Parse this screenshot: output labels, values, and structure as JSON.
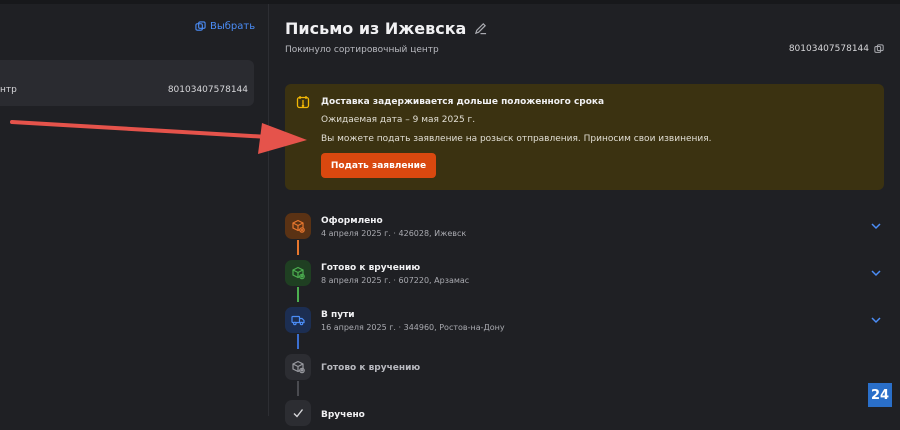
{
  "left_panel": {
    "select_label": "Выбрать",
    "item": {
      "suffix": "нтр",
      "tracking": "80103407578144"
    }
  },
  "header": {
    "title": "Письмо из Ижевска",
    "status": "Покинуло сортировочный центр",
    "tracking": "80103407578144"
  },
  "alert": {
    "heading": "Доставка задерживается дольше положенного срока",
    "expected": "Ожидаемая дата – 9 мая 2025 г.",
    "message": "Вы можете подать заявление на розыск отправления. Приносим свои извинения.",
    "button": "Подать заявление"
  },
  "timeline": [
    {
      "name": "Оформлено",
      "details": "4 апреля 2025 г. · 426028, Ижевск",
      "icon": "box-plus-icon",
      "color": "#e8772e"
    },
    {
      "name": "Готово к вручению",
      "details": "8 апреля 2025 г. · 607220, Арзамас",
      "icon": "box-location-icon",
      "color": "#4caf50"
    },
    {
      "name": "В пути",
      "details": "16 апреля 2025 г. · 344960, Ростов-на-Дону",
      "icon": "truck-icon",
      "color": "#4b8df7"
    },
    {
      "name": "Готово к вручению",
      "details": "",
      "icon": "box-location-icon",
      "color": "#9a9ba1"
    },
    {
      "name": "Вручено",
      "details": "",
      "icon": "check-icon",
      "color": "#9a9ba1"
    }
  ],
  "colors": {
    "accent_blue": "#4b8df7",
    "alert_bg": "#3b3211",
    "button_orange": "#d9480f",
    "arrow_red": "#e5534b"
  },
  "badge": "24"
}
